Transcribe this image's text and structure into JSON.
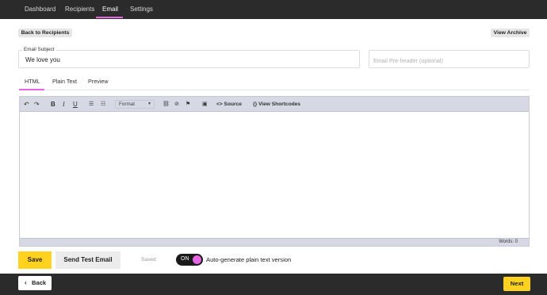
{
  "nav": {
    "tabs": [
      {
        "label": "Dashboard"
      },
      {
        "label": "Recipients"
      },
      {
        "label": "Email"
      },
      {
        "label": "Settings"
      }
    ],
    "active_tab": "Email"
  },
  "actions": {
    "back_to_recipients": "Back to Recipients",
    "view_archive": "View Archive"
  },
  "subject": {
    "label": "Email Subject",
    "value": "We love you"
  },
  "preheader": {
    "placeholder": "Email Pre-header (optional)"
  },
  "editor_tabs": [
    {
      "label": "HTML"
    },
    {
      "label": "Plain Text"
    },
    {
      "label": "Preview"
    }
  ],
  "toolbar": {
    "format_label": "Format",
    "source_label": "Source",
    "shortcodes_label": "View Shortcodes"
  },
  "status": {
    "words": "Words: 0"
  },
  "footer": {
    "save_label": "Save",
    "send_test_label": "Send Test Email",
    "saved_text": "Saved",
    "toggle_state": "ON",
    "toggle_label": "Auto-generate plain text version"
  },
  "bottom": {
    "back_label": "Back",
    "next_label": "Next"
  },
  "colors": {
    "accent": "#e466e4",
    "primary": "#ffd21f",
    "dark": "#2b2b2b"
  }
}
